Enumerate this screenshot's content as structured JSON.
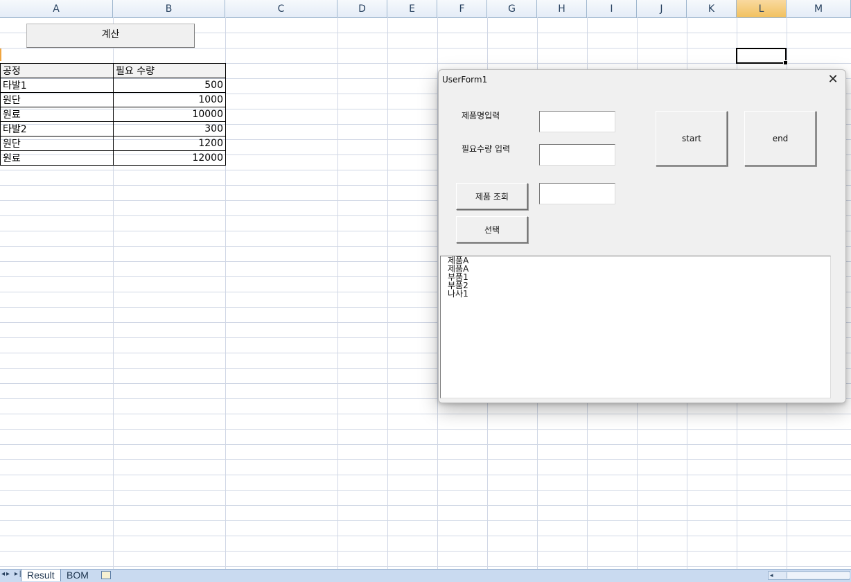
{
  "sheet": {
    "columns": [
      "A",
      "B",
      "C",
      "D",
      "E",
      "F",
      "G",
      "H",
      "I",
      "J",
      "K",
      "L",
      "M"
    ],
    "active_column": "L",
    "calc_button_label": "계산",
    "table": {
      "headers": [
        "공정",
        "필요 수량"
      ],
      "rows": [
        [
          "타발1",
          "500"
        ],
        [
          "원단",
          "1000"
        ],
        [
          "원료",
          "10000"
        ],
        [
          "타발2",
          "300"
        ],
        [
          "원단",
          "1200"
        ],
        [
          "원료",
          "12000"
        ]
      ]
    }
  },
  "tabs": {
    "nav_arrows": "◂▸ ▸|",
    "sheets": [
      "Result",
      "BOM"
    ]
  },
  "userform": {
    "title": "UserForm1",
    "close_glyph": "✕",
    "product_name_label": "제품명입력",
    "quantity_label": "필요수량 입력",
    "product_name_value": "",
    "quantity_value": "",
    "lookup_value": "",
    "start_label": "start",
    "end_label": "end",
    "lookup_button_label": "제품 조회",
    "select_button_label": "선택",
    "list_items": [
      "제품A",
      "제품A",
      "부품1",
      "부품2",
      "나사1"
    ]
  }
}
